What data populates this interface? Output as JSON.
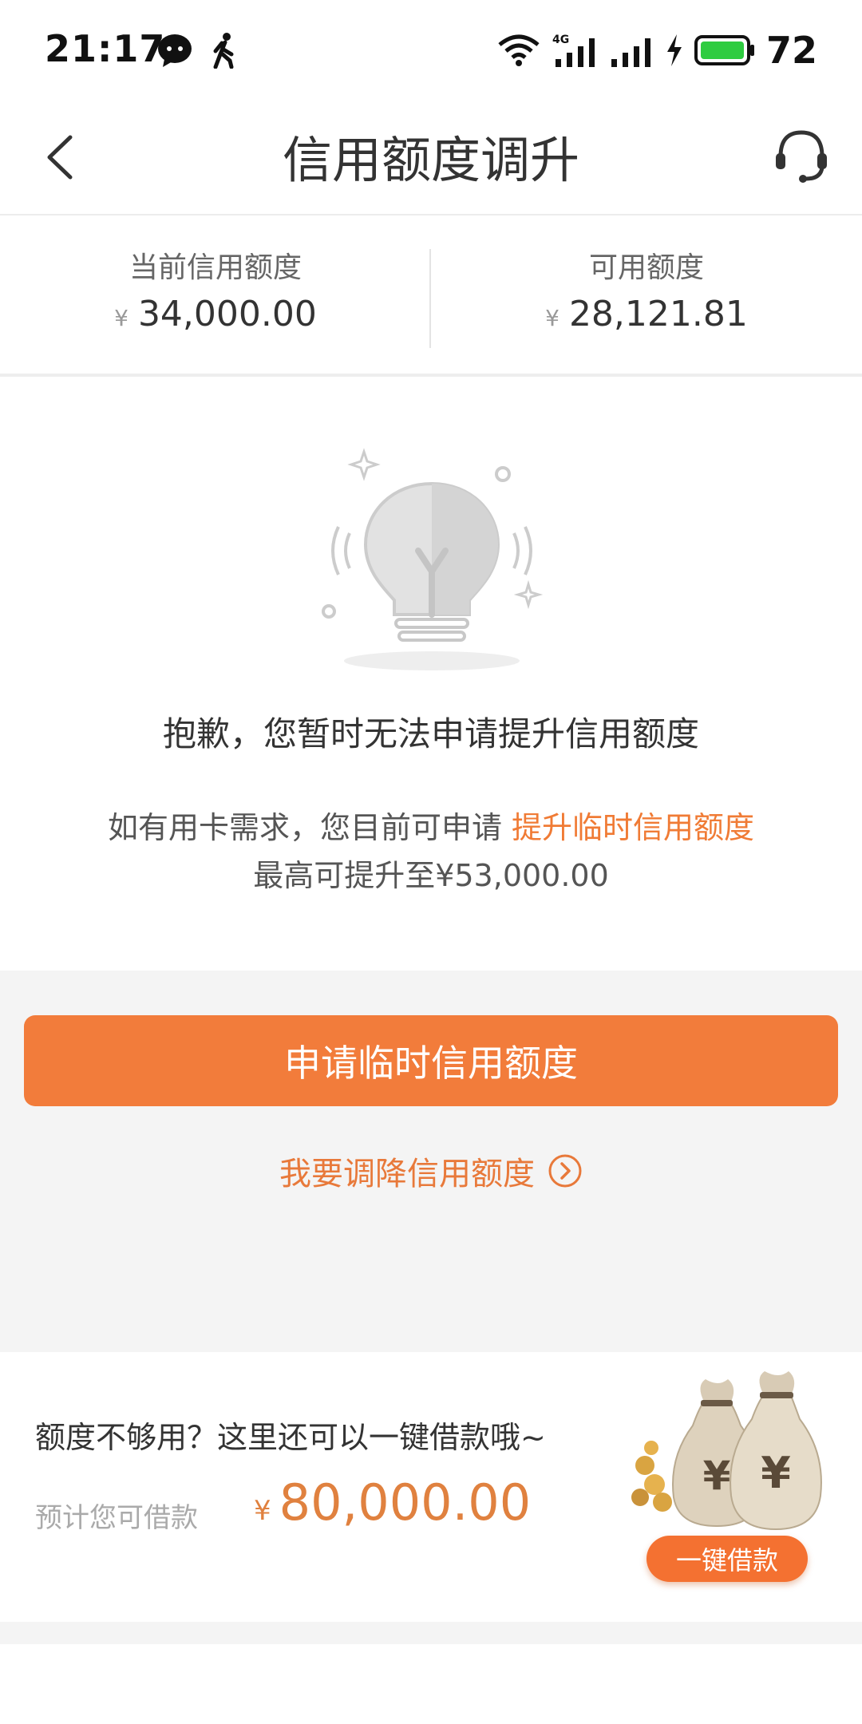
{
  "status_bar": {
    "time": "21:17",
    "battery": "72",
    "icons": [
      "chat-bubble-icon",
      "walking-icon",
      "wifi-icon",
      "signal-4g-icon",
      "signal-icon",
      "charging-icon",
      "battery-icon"
    ]
  },
  "header": {
    "title": "信用额度调升",
    "back_icon": "chevron-left-icon",
    "support_icon": "headset-icon"
  },
  "summary": {
    "current_label": "当前信用额度",
    "current_currency": "¥",
    "current_value": "34,000.00",
    "available_label": "可用额度",
    "available_currency": "¥",
    "available_value": "28,121.81"
  },
  "notice": {
    "illustration": "lightbulb-icon",
    "title": "抱歉，您暂时无法申请提升信用额度",
    "line1_prefix": "如有用卡需求，您目前可申请 ",
    "line1_link": "提升临时信用额度",
    "line2": "最高可提升至¥53,000.00"
  },
  "actions": {
    "apply_label": "申请临时信用额度",
    "reduce_label": "我要调降信用额度",
    "reduce_icon": "chevron-circle-right-icon"
  },
  "promo": {
    "text": "额度不够用？这里还可以一键借款哦~",
    "estimate_label": "预计您可借款",
    "currency": "¥",
    "amount": "80,000.00",
    "button_label": "一键借款",
    "illustration": "money-bags-icon"
  },
  "colors": {
    "accent": "#f27c3b",
    "link": "#f07b35",
    "background_gray": "#f4f4f4"
  }
}
